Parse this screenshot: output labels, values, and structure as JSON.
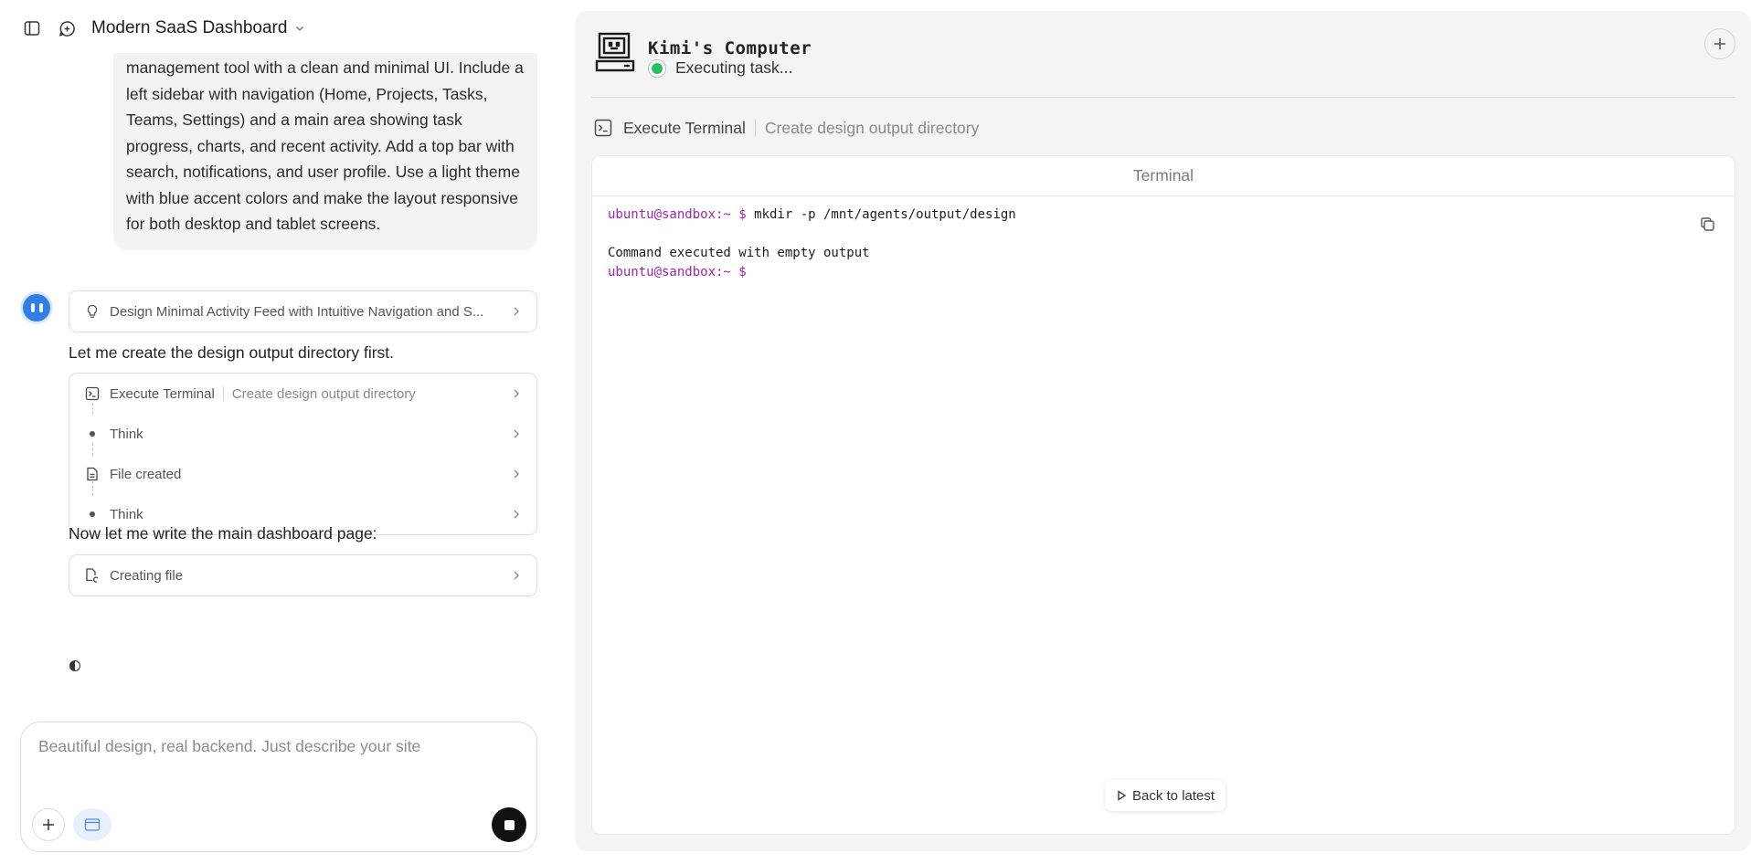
{
  "header": {
    "title": "Modern SaaS Dashboard"
  },
  "chat": {
    "user_message": "management tool with a clean and minimal UI. Include a left sidebar with navigation (Home, Projects, Tasks, Teams, Settings) and a main area showing task progress, charts, and recent activity. Add a top bar with search, notifications, and user profile. Use a light theme with blue accent colors and make the layout responsive for both desktop and tablet screens.",
    "plan_card": "Design Minimal Activity Feed with Intuitive Navigation and S...",
    "assistant_text_1": "Let me create the design output directory first.",
    "steps": [
      {
        "label": "Execute Terminal",
        "sub": "Create design output directory"
      },
      {
        "label": "Think"
      },
      {
        "label": "File created"
      },
      {
        "label": "Think"
      }
    ],
    "assistant_text_2": "Now let me write the main dashboard page:",
    "creating_card": "Creating file"
  },
  "composer": {
    "placeholder": "Beautiful design, real backend. Just describe your site"
  },
  "computer": {
    "title": "Kimi's Computer",
    "status": "Executing task...",
    "status_color": "#22c35e",
    "crumb_label": "Execute Terminal",
    "crumb_sub": "Create design output directory",
    "terminal_title": "Terminal",
    "lines": {
      "prompt1": "ubuntu@sandbox:~ $",
      "cmd1": " mkdir -p /mnt/agents/output/design",
      "output": "Command executed with empty output",
      "prompt2": "ubuntu@sandbox:~ $"
    },
    "back_to_latest": "Back to latest",
    "prompt_color": "#9b27af"
  }
}
